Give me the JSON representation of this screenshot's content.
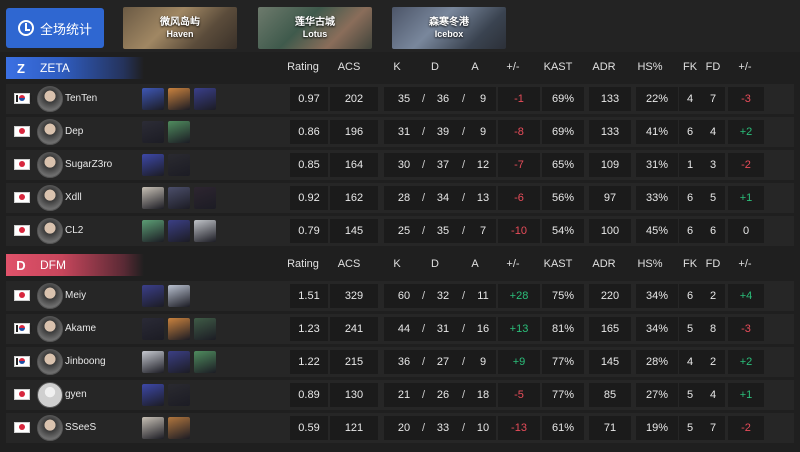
{
  "top": {
    "all_stats_label": "全场统计",
    "maps": [
      {
        "cn": "微风岛屿",
        "en": "Haven",
        "key": "map-tab-haven"
      },
      {
        "cn": "莲华古城",
        "en": "Lotus",
        "key": "map-tab-lotus"
      },
      {
        "cn": "森寒冬港",
        "en": "Icebox",
        "key": "map-tab-icebox"
      }
    ]
  },
  "columns": {
    "rating": "Rating",
    "acs": "ACS",
    "k": "K",
    "d": "D",
    "a": "A",
    "pm": "+/-",
    "kast": "KAST",
    "adr": "ADR",
    "hs": "HS%",
    "fk": "FK",
    "fd": "FD",
    "pm2": "+/-"
  },
  "teams": [
    {
      "name": "ZETA",
      "logo": "Z",
      "players": [
        {
          "name": "TenTen",
          "flag": "kr",
          "agents": [
            "#3e57b5",
            "#c9823e",
            "#3a3f8a"
          ],
          "rating": "0.97",
          "acs": "202",
          "k": "35",
          "d": "36",
          "a": "9",
          "pm": "-1",
          "kast": "69%",
          "adr": "133",
          "hs": "22%",
          "fk": "4",
          "fd": "7",
          "pm2": "-3"
        },
        {
          "name": "Dep",
          "flag": "jp",
          "agents": [
            "#2c2c36",
            "#4f8c5e"
          ],
          "rating": "0.86",
          "acs": "196",
          "k": "31",
          "d": "39",
          "a": "9",
          "pm": "-8",
          "kast": "69%",
          "adr": "133",
          "hs": "41%",
          "fk": "6",
          "fd": "4",
          "pm2": "+2"
        },
        {
          "name": "SugarZ3ro",
          "flag": "jp",
          "agents": [
            "#3d48a8",
            "#2a2a30"
          ],
          "rating": "0.85",
          "acs": "164",
          "k": "30",
          "d": "37",
          "a": "12",
          "pm": "-7",
          "kast": "65%",
          "adr": "109",
          "hs": "31%",
          "fk": "1",
          "fd": "3",
          "pm2": "-2"
        },
        {
          "name": "Xdll",
          "flag": "jp",
          "agents": [
            "#c7c0b5",
            "#4b4e6a",
            "#2d2530"
          ],
          "rating": "0.92",
          "acs": "162",
          "k": "28",
          "d": "34",
          "a": "13",
          "pm": "-6",
          "kast": "56%",
          "adr": "97",
          "hs": "33%",
          "fk": "6",
          "fd": "5",
          "pm2": "+1"
        },
        {
          "name": "CL2",
          "flag": "jp",
          "agents": [
            "#5c9e75",
            "#3b3f85",
            "#c0c3c8"
          ],
          "rating": "0.79",
          "acs": "145",
          "k": "25",
          "d": "35",
          "a": "7",
          "pm": "-10",
          "kast": "54%",
          "adr": "100",
          "hs": "45%",
          "fk": "6",
          "fd": "6",
          "pm2": "0"
        }
      ]
    },
    {
      "name": "DFM",
      "logo": "D",
      "players": [
        {
          "name": "Meiy",
          "flag": "jp",
          "agents": [
            "#3b3f8a",
            "#b8c0cf"
          ],
          "rating": "1.51",
          "acs": "329",
          "k": "60",
          "d": "32",
          "a": "11",
          "pm": "+28",
          "kast": "75%",
          "adr": "220",
          "hs": "34%",
          "fk": "6",
          "fd": "2",
          "pm2": "+4"
        },
        {
          "name": "Akame",
          "flag": "kr",
          "agents": [
            "#2a2a36",
            "#c9823e",
            "#3f5b46"
          ],
          "rating": "1.23",
          "acs": "241",
          "k": "44",
          "d": "31",
          "a": "16",
          "pm": "+13",
          "kast": "81%",
          "adr": "165",
          "hs": "34%",
          "fk": "5",
          "fd": "8",
          "pm2": "-3"
        },
        {
          "name": "Jinboong",
          "flag": "kr",
          "agents": [
            "#c5c8cf",
            "#3b3f85",
            "#4f8c5e"
          ],
          "rating": "1.22",
          "acs": "215",
          "k": "36",
          "d": "27",
          "a": "9",
          "pm": "+9",
          "kast": "77%",
          "adr": "145",
          "hs": "28%",
          "fk": "4",
          "fd": "2",
          "pm2": "+2"
        },
        {
          "name": "gyen",
          "flag": "jp",
          "blank": true,
          "agents": [
            "#3d48a8",
            "#2a2a30"
          ],
          "rating": "0.89",
          "acs": "130",
          "k": "21",
          "d": "26",
          "a": "18",
          "pm": "-5",
          "kast": "77%",
          "adr": "85",
          "hs": "27%",
          "fk": "5",
          "fd": "4",
          "pm2": "+1"
        },
        {
          "name": "SSeeS",
          "flag": "jp",
          "agents": [
            "#c7c0b5",
            "#b0763e"
          ],
          "rating": "0.59",
          "acs": "121",
          "k": "20",
          "d": "33",
          "a": "10",
          "pm": "-13",
          "kast": "61%",
          "adr": "71",
          "hs": "19%",
          "fk": "5",
          "fd": "7",
          "pm2": "-2"
        }
      ]
    }
  ]
}
